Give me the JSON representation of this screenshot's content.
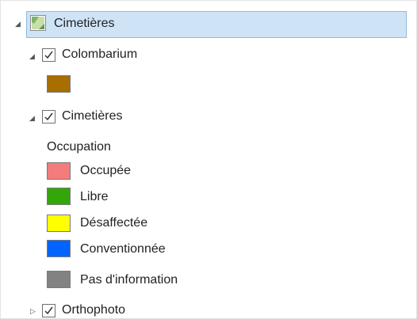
{
  "tree": {
    "root": {
      "label": "Cimetières",
      "icon": "map-layer-icon"
    },
    "colombarium": {
      "label": "Colombarium",
      "checked": true,
      "swatch_color": "#a86e00"
    },
    "cimetieres": {
      "label": "Cimetières",
      "checked": true,
      "field_heading": "Occupation",
      "classes": [
        {
          "label": "Occupée",
          "color": "#f47c7c"
        },
        {
          "label": "Libre",
          "color": "#33a70a"
        },
        {
          "label": "Désaffectée",
          "color": "#ffff00"
        },
        {
          "label": "Conventionnée",
          "color": "#0064ff"
        },
        {
          "label": "Pas d'information",
          "color": "#828282"
        }
      ]
    },
    "orthophoto": {
      "label": "Orthophoto",
      "checked": true
    }
  },
  "colors": {
    "selection_bg": "#cfe3f7",
    "selection_border": "#90b8e0"
  }
}
